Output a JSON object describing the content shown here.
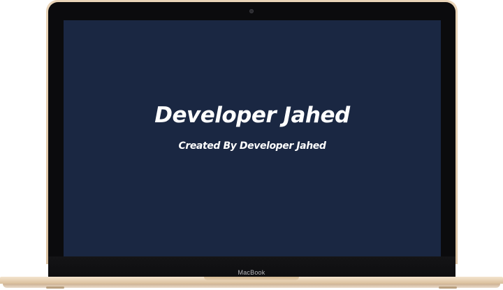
{
  "screen": {
    "title": "Developer Jahed",
    "subtitle": "Created By Developer Jahed",
    "background_color": "#1a2742"
  },
  "device": {
    "brand_label": "MacBook",
    "finish_color": "#e6d0b2"
  }
}
